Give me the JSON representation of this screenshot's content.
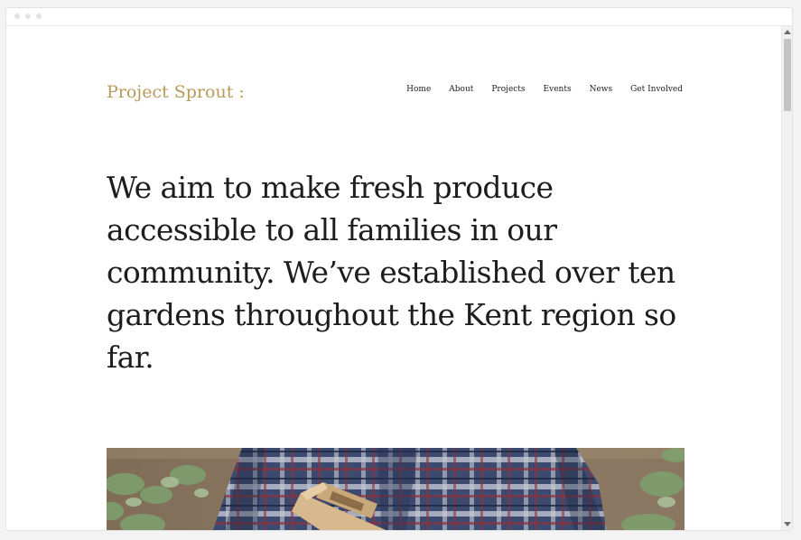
{
  "site": {
    "logo": "Project Sprout :",
    "nav": [
      "Home",
      "About",
      "Projects",
      "Events",
      "News",
      "Get Involved"
    ],
    "hero_text": "We aim to make fresh produce accessible to all families in our community. We’ve established over ten gardens throughout the Kent region so far."
  },
  "colors": {
    "logo": "#b89a5a",
    "text": "#1d1d1d",
    "background": "#ffffff"
  },
  "icons": [
    "window-dot-icon",
    "scroll-up-arrow-icon",
    "scroll-down-arrow-icon"
  ]
}
